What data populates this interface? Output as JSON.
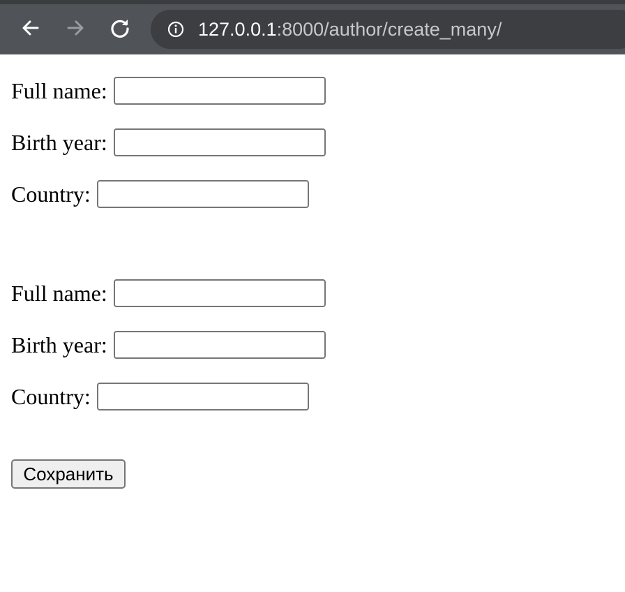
{
  "browser": {
    "url_host": "127.0.0.1",
    "url_rest": ":8000/author/create_many/"
  },
  "icons": {
    "back": "back-arrow-icon",
    "forward": "forward-arrow-icon",
    "reload": "reload-icon",
    "info": "info-icon"
  },
  "colors": {
    "toolbar": "#505357",
    "omnibox": "#3c3e42",
    "input_border": "#767676",
    "button_bg": "#efefef"
  },
  "forms": [
    {
      "full_name_label": "Full name:",
      "full_name_value": "",
      "birth_year_label": "Birth year:",
      "birth_year_value": "",
      "country_label": "Country:",
      "country_value": ""
    },
    {
      "full_name_label": "Full name:",
      "full_name_value": "",
      "birth_year_label": "Birth year:",
      "birth_year_value": "",
      "country_label": "Country:",
      "country_value": ""
    }
  ],
  "submit_label": "Сохранить"
}
